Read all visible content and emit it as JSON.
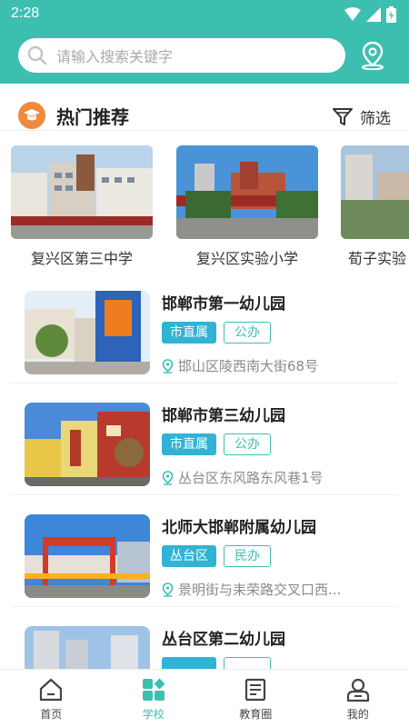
{
  "status": {
    "time": "2:28"
  },
  "search": {
    "placeholder": "请输入搜索关键字"
  },
  "section": {
    "title": "热门推荐",
    "filter_label": "筛选"
  },
  "recommended": [
    {
      "name": "复兴区第三中学"
    },
    {
      "name": "复兴区实验小学"
    },
    {
      "name": "荀子实验"
    }
  ],
  "schools": [
    {
      "name": "邯郸市第一幼儿园",
      "tag1": "市直属",
      "tag2": "公办",
      "address": "邯山区陵西南大街68号"
    },
    {
      "name": "邯郸市第三幼儿园",
      "tag1": "市直属",
      "tag2": "公办",
      "address": "丛台区东风路东风巷1号"
    },
    {
      "name": "北师大邯郸附属幼儿园",
      "tag1": "丛台区",
      "tag2": "民办",
      "address": "景明街与耒荣路交叉口西..."
    },
    {
      "name": "丛台区第二幼儿园",
      "tag1": "",
      "tag2": "",
      "address": ""
    }
  ],
  "tabs": [
    {
      "label": "首页",
      "icon": "home-icon"
    },
    {
      "label": "学校",
      "icon": "school-icon"
    },
    {
      "label": "教育圈",
      "icon": "article-icon"
    },
    {
      "label": "我的",
      "icon": "profile-icon"
    }
  ],
  "colors": {
    "primary": "#3dbfb0",
    "tag_blue": "#31b3d6",
    "hot_orange": "#f08a3c"
  }
}
